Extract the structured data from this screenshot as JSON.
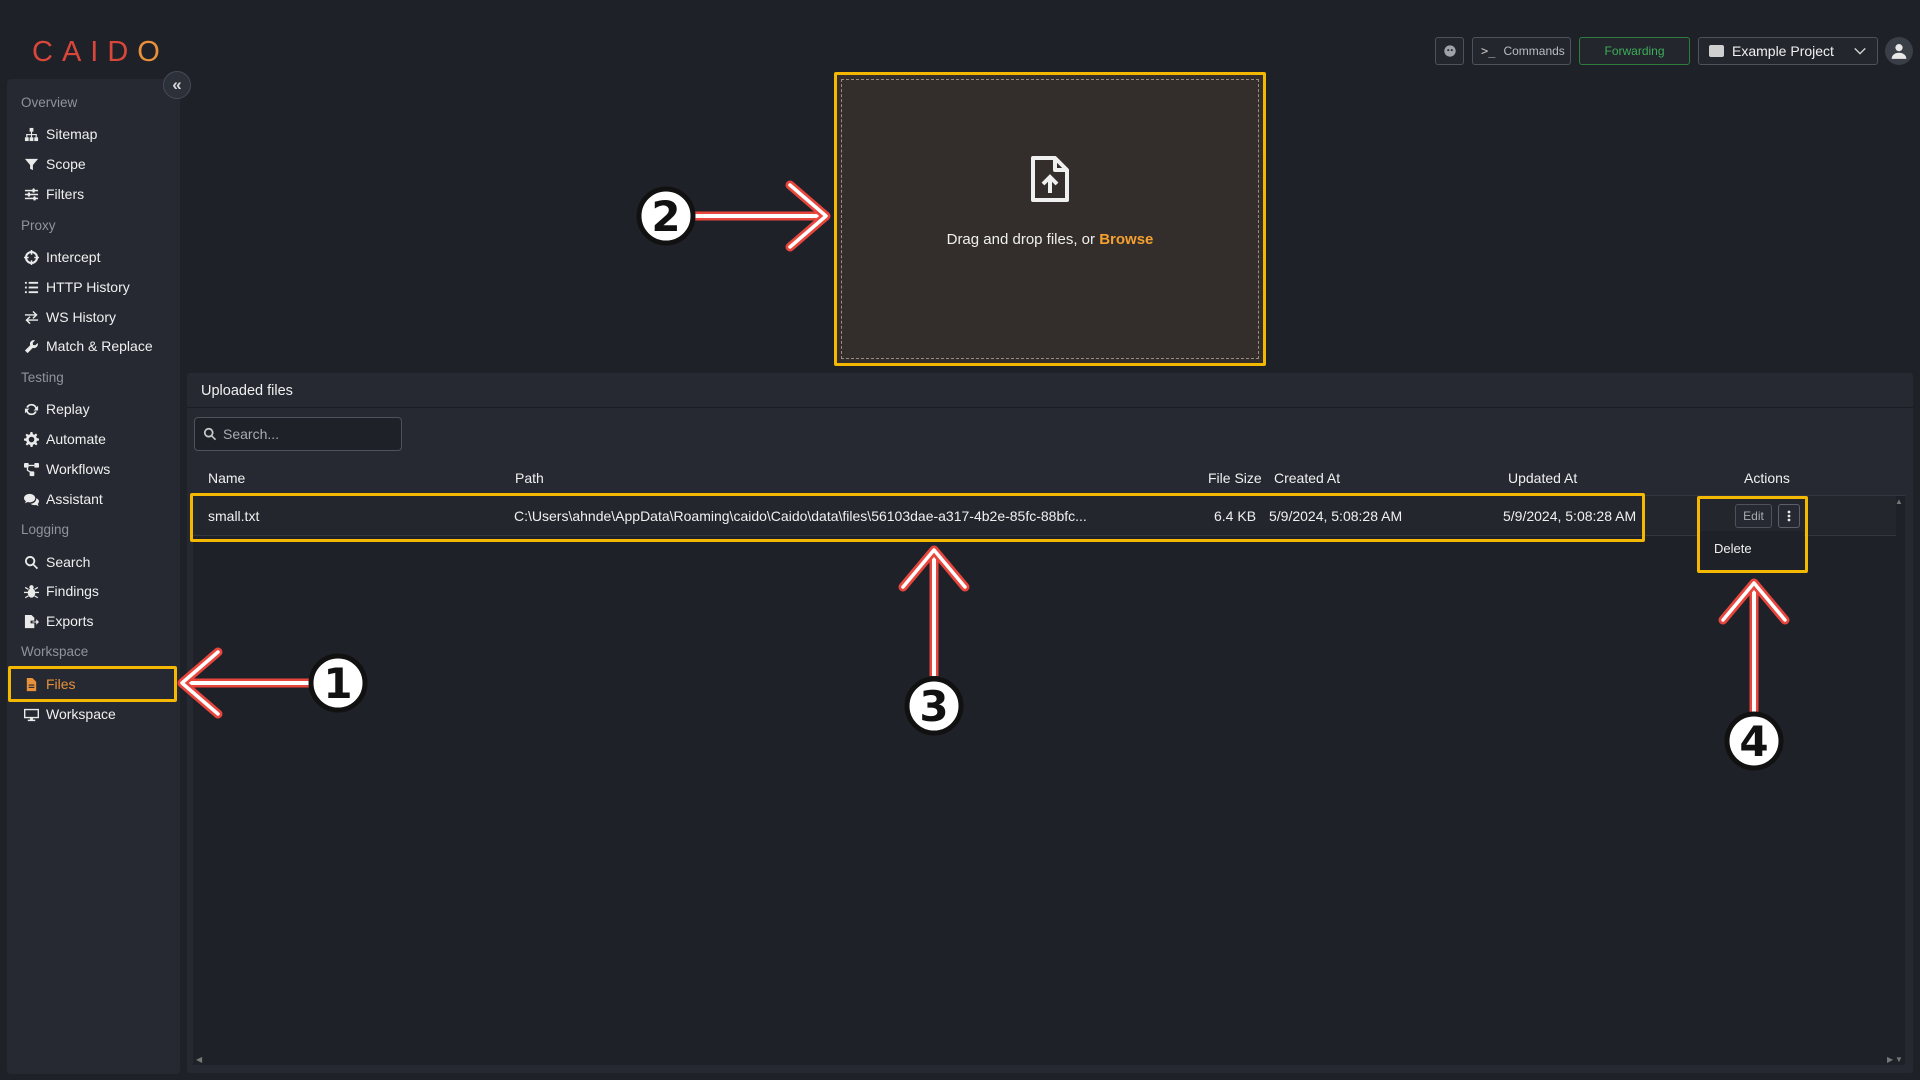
{
  "app": {
    "logo_text_1": "CAID",
    "logo_text_2": "O"
  },
  "sidebar": {
    "sections": [
      {
        "label": "Overview",
        "items": [
          {
            "label": "Sitemap",
            "icon": "sitemap-icon"
          },
          {
            "label": "Scope",
            "icon": "filter-funnel-icon"
          },
          {
            "label": "Filters",
            "icon": "sliders-icon"
          }
        ]
      },
      {
        "label": "Proxy",
        "items": [
          {
            "label": "Intercept",
            "icon": "crosshair-icon"
          },
          {
            "label": "HTTP History",
            "icon": "list-icon"
          },
          {
            "label": "WS History",
            "icon": "swap-arrows-icon"
          },
          {
            "label": "Match & Replace",
            "icon": "wrench-icon"
          }
        ]
      },
      {
        "label": "Testing",
        "items": [
          {
            "label": "Replay",
            "icon": "refresh-icon"
          },
          {
            "label": "Automate",
            "icon": "cog-icon"
          },
          {
            "label": "Workflows",
            "icon": "workflow-icon"
          },
          {
            "label": "Assistant",
            "icon": "chat-icon"
          }
        ]
      },
      {
        "label": "Logging",
        "items": [
          {
            "label": "Search",
            "icon": "search-icon"
          },
          {
            "label": "Findings",
            "icon": "bug-icon"
          },
          {
            "label": "Exports",
            "icon": "export-icon"
          }
        ]
      },
      {
        "label": "Workspace",
        "items": [
          {
            "label": "Files",
            "icon": "file-icon",
            "active": true
          },
          {
            "label": "Workspace",
            "icon": "monitor-icon"
          }
        ]
      }
    ]
  },
  "topbar": {
    "commands_label": "Commands",
    "forwarding_label": "Forwarding",
    "project_label": "Example Project"
  },
  "dropzone": {
    "text": "Drag and drop files, or ",
    "browse_label": "Browse"
  },
  "files_panel": {
    "title": "Uploaded files",
    "search_placeholder": "Search...",
    "columns": [
      "Name",
      "Path",
      "File Size",
      "Created At",
      "Updated At",
      "Actions"
    ],
    "rows": [
      {
        "name": "small.txt",
        "path": "C:\\Users\\ahnde\\AppData\\Roaming\\caido\\Caido\\data\\files\\56103dae-a317-4b2e-85fc-88bfc...",
        "size": "6.4 KB",
        "created": "5/9/2024, 5:08:28 AM",
        "updated": "5/9/2024, 5:08:28 AM"
      }
    ],
    "edit_label": "Edit",
    "menu_delete_label": "Delete"
  },
  "annotations": {
    "numbers": [
      "1",
      "2",
      "3",
      "4"
    ],
    "highlight_color": "#f5b800",
    "arrow_color": "#e8453c"
  },
  "colors": {
    "background": "#1f2128",
    "panel": "#262931",
    "accent_orange": "#e8903a",
    "forwarding_green": "#3dae5a"
  }
}
